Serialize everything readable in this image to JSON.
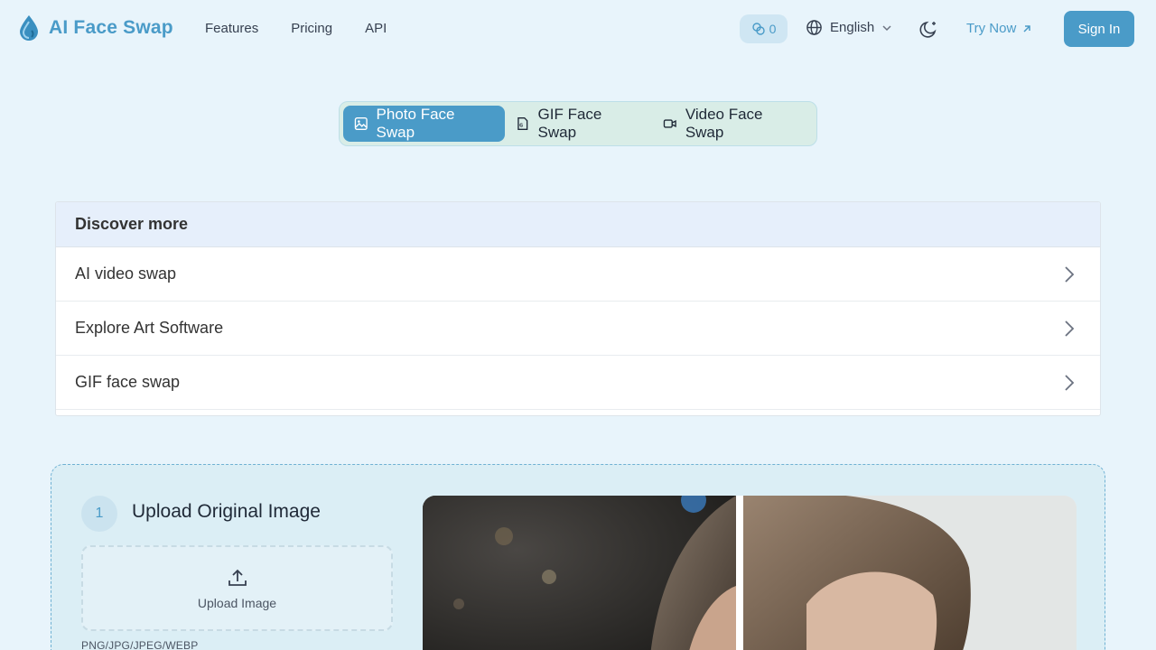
{
  "header": {
    "logo_text": "AI Face Swap",
    "nav": [
      "Features",
      "Pricing",
      "API"
    ],
    "credits": "0",
    "language": "English",
    "try_now": "Try Now",
    "sign_in": "Sign In"
  },
  "mode_tabs": [
    {
      "label": "Photo Face Swap",
      "icon": "image-icon",
      "active": true
    },
    {
      "label": "GIF Face Swap",
      "icon": "file-gif-icon",
      "active": false
    },
    {
      "label": "Video Face Swap",
      "icon": "video-icon",
      "active": false
    }
  ],
  "discover": {
    "title": "Discover more",
    "items": [
      "AI video swap",
      "Explore Art Software",
      "GIF face swap"
    ]
  },
  "upload": {
    "step": "1",
    "title": "Upload Original Image",
    "button_label": "Upload Image",
    "formats": "PNG/JPG/JPEG/WEBP"
  },
  "colors": {
    "accent": "#4a9bc8",
    "background": "#e8f4fb"
  }
}
